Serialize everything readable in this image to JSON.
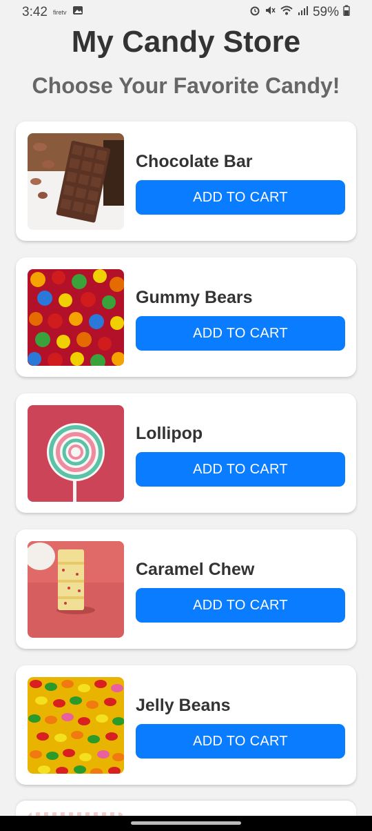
{
  "status": {
    "time": "3:42",
    "app_badge": "firetv",
    "battery": "59%"
  },
  "header": {
    "title": "My Candy Store",
    "subtitle": "Choose Your Favorite Candy!"
  },
  "products": [
    {
      "name": "Chocolate Bar",
      "button": "ADD TO CART",
      "image": "chocolate-bar"
    },
    {
      "name": "Gummy Bears",
      "button": "ADD TO CART",
      "image": "gummy-bears"
    },
    {
      "name": "Lollipop",
      "button": "ADD TO CART",
      "image": "lollipop"
    },
    {
      "name": "Caramel Chew",
      "button": "ADD TO CART",
      "image": "caramel-chew"
    },
    {
      "name": "Jelly Beans",
      "button": "ADD TO CART",
      "image": "jelly-beans"
    }
  ],
  "colors": {
    "accent": "#0a7cff",
    "background": "#f2f2f2"
  }
}
